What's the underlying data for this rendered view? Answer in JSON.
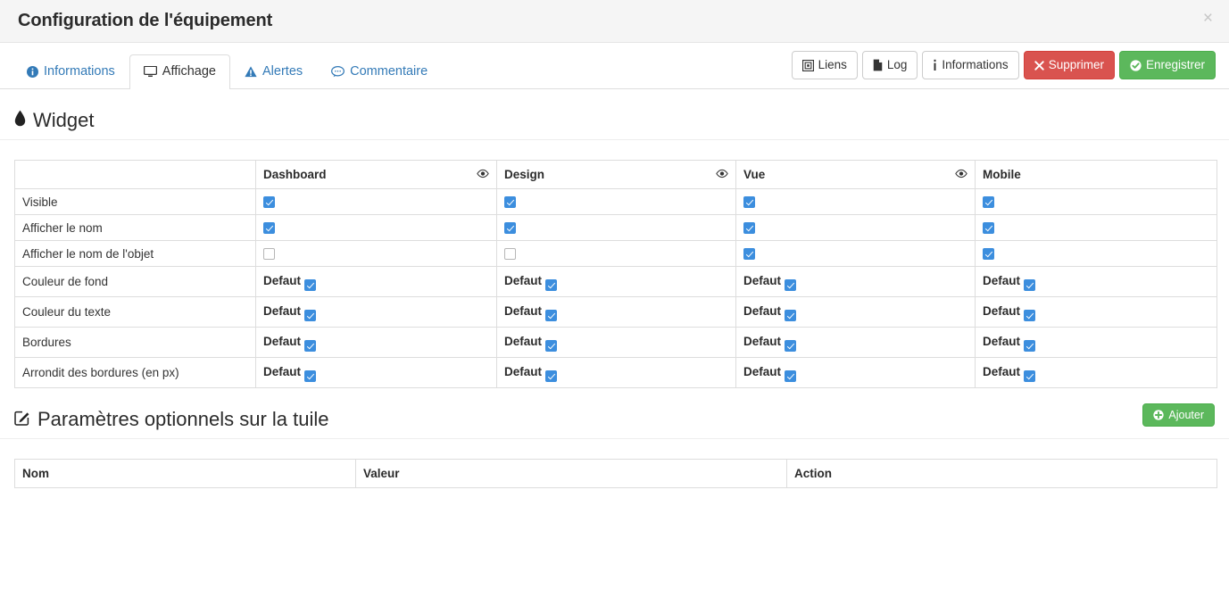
{
  "modal": {
    "title": "Configuration de l'équipement",
    "close_label": "×",
    "close_icon": "close-icon"
  },
  "tabs": [
    {
      "label": "Informations",
      "icon": "info-circle-icon",
      "active": false
    },
    {
      "label": "Affichage",
      "icon": "desktop-icon",
      "active": true
    },
    {
      "label": "Alertes",
      "icon": "warning-triangle-icon",
      "active": false
    },
    {
      "label": "Commentaire",
      "icon": "comment-icon",
      "active": false
    }
  ],
  "tab_actions": [
    {
      "label": "Liens",
      "icon": "sitemap-icon",
      "style": "default"
    },
    {
      "label": "Log",
      "icon": "file-icon",
      "style": "default"
    },
    {
      "label": "Informations",
      "icon": "info-icon",
      "style": "default"
    },
    {
      "label": "Supprimer",
      "icon": "times-icon",
      "style": "danger"
    },
    {
      "label": "Enregistrer",
      "icon": "check-circle-icon",
      "style": "success"
    }
  ],
  "widget_section": {
    "title": "Widget",
    "icon": "tint-droplet-icon"
  },
  "widget_table": {
    "columns": [
      {
        "label": "",
        "eye": false
      },
      {
        "label": "Dashboard",
        "eye": true,
        "eye_icon": "eye-icon"
      },
      {
        "label": "Design",
        "eye": true,
        "eye_icon": "eye-icon"
      },
      {
        "label": "Vue",
        "eye": true,
        "eye_icon": "eye-icon"
      },
      {
        "label": "Mobile",
        "eye": false
      }
    ],
    "rows": [
      {
        "label": "Visible",
        "type": "checkbox",
        "cells": [
          {
            "checked": true
          },
          {
            "checked": true
          },
          {
            "checked": true
          },
          {
            "checked": true
          }
        ]
      },
      {
        "label": "Afficher le nom",
        "type": "checkbox",
        "cells": [
          {
            "checked": true
          },
          {
            "checked": true
          },
          {
            "checked": true
          },
          {
            "checked": true
          }
        ]
      },
      {
        "label": "Afficher le nom de l'objet",
        "type": "checkbox",
        "cells": [
          {
            "checked": false
          },
          {
            "checked": false
          },
          {
            "checked": true
          },
          {
            "checked": true
          }
        ]
      },
      {
        "label": "Couleur de fond",
        "type": "default",
        "cells": [
          {
            "text": "Defaut",
            "checked": true
          },
          {
            "text": "Defaut",
            "checked": true
          },
          {
            "text": "Defaut",
            "checked": true
          },
          {
            "text": "Defaut",
            "checked": true
          }
        ]
      },
      {
        "label": "Couleur du texte",
        "type": "default",
        "cells": [
          {
            "text": "Defaut",
            "checked": true
          },
          {
            "text": "Defaut",
            "checked": true
          },
          {
            "text": "Defaut",
            "checked": true
          },
          {
            "text": "Defaut",
            "checked": true
          }
        ]
      },
      {
        "label": "Bordures",
        "type": "default",
        "cells": [
          {
            "text": "Defaut",
            "checked": true
          },
          {
            "text": "Defaut",
            "checked": true
          },
          {
            "text": "Defaut",
            "checked": true
          },
          {
            "text": "Defaut",
            "checked": true
          }
        ]
      },
      {
        "label": "Arrondit des bordures (en px)",
        "type": "default",
        "cells": [
          {
            "text": "Defaut",
            "checked": true
          },
          {
            "text": "Defaut",
            "checked": true
          },
          {
            "text": "Defaut",
            "checked": true
          },
          {
            "text": "Defaut",
            "checked": true
          }
        ]
      }
    ]
  },
  "tile_section": {
    "title": "Paramètres optionnels sur la tuile",
    "icon": "edit-pencil-icon",
    "add_label": "Ajouter",
    "add_icon": "plus-circle-icon"
  },
  "tile_table": {
    "columns": [
      "Nom",
      "Valeur",
      "Action"
    ],
    "rows": []
  },
  "colors": {
    "accent_blue": "#337ab7",
    "checkbox_blue": "#3c8ede",
    "danger_red": "#d9534f",
    "success_green": "#5cb85c",
    "header_bg": "#f5f5f5",
    "border_gray": "#dddddd"
  }
}
